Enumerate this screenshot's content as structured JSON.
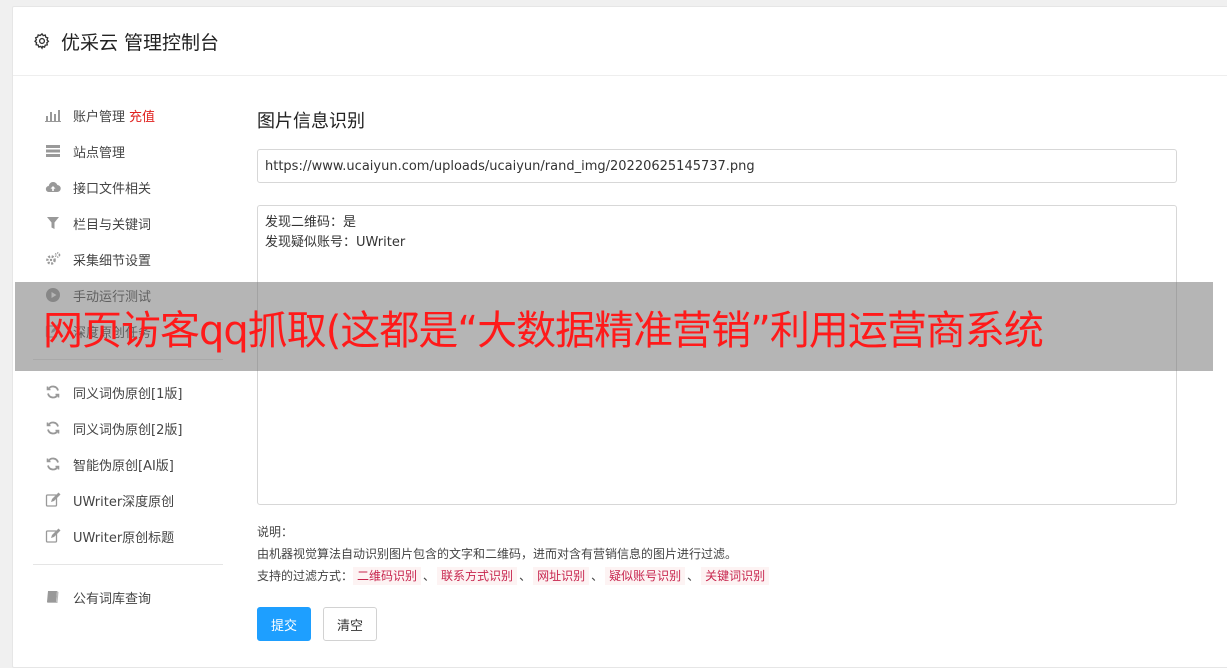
{
  "header": {
    "title": "优采云 管理控制台"
  },
  "sidebar": {
    "groups": [
      [
        {
          "label": "账户管理",
          "badge": "充值",
          "icon": "bar-chart-icon"
        },
        {
          "label": "站点管理",
          "icon": "server-icon"
        },
        {
          "label": "接口文件相关",
          "icon": "cloud-upload-icon"
        },
        {
          "label": "栏目与关键词",
          "icon": "filter-icon"
        },
        {
          "label": "采集细节设置",
          "icon": "gears-icon"
        },
        {
          "label": "手动运行测试",
          "icon": "play-icon"
        },
        {
          "label": "深度原创任务",
          "icon": "edit-icon"
        }
      ],
      [
        {
          "label": "同义词伪原创[1版]",
          "icon": "refresh-icon"
        },
        {
          "label": "同义词伪原创[2版]",
          "icon": "refresh-icon"
        },
        {
          "label": "智能伪原创[AI版]",
          "icon": "refresh-icon"
        },
        {
          "label": "UWriter深度原创",
          "icon": "edit-icon"
        },
        {
          "label": "UWriter原创标题",
          "icon": "edit-icon"
        }
      ],
      [
        {
          "label": "公有词库查询",
          "icon": "book-icon"
        }
      ]
    ]
  },
  "main": {
    "title": "图片信息识别",
    "url_value": "https://www.ucaiyun.com/uploads/ucaiyun/rand_img/20220625145737.png",
    "result_text": "发现二维码：是\n发现疑似账号：UWriter",
    "notes_label": "说明：",
    "notes_desc": "由机器视觉算法自动识别图片包含的文字和二维码，进而对含有营销信息的图片进行过滤。",
    "filters_label": "支持的过滤方式：",
    "filters": [
      "二维码识别",
      "联系方式识别",
      "网址识别",
      "疑似账号识别",
      "关键词识别"
    ],
    "filter_sep": "、",
    "submit_label": "提交",
    "clear_label": "清空"
  },
  "overlay": {
    "text": "网页访客qq抓取(这都是“大数据精准营销”利用运营商系统"
  },
  "colors": {
    "accent": "#1e9fff",
    "badge": "#e0201d",
    "overlay_text": "#ff1a1a",
    "tag_text": "#c7254e"
  }
}
